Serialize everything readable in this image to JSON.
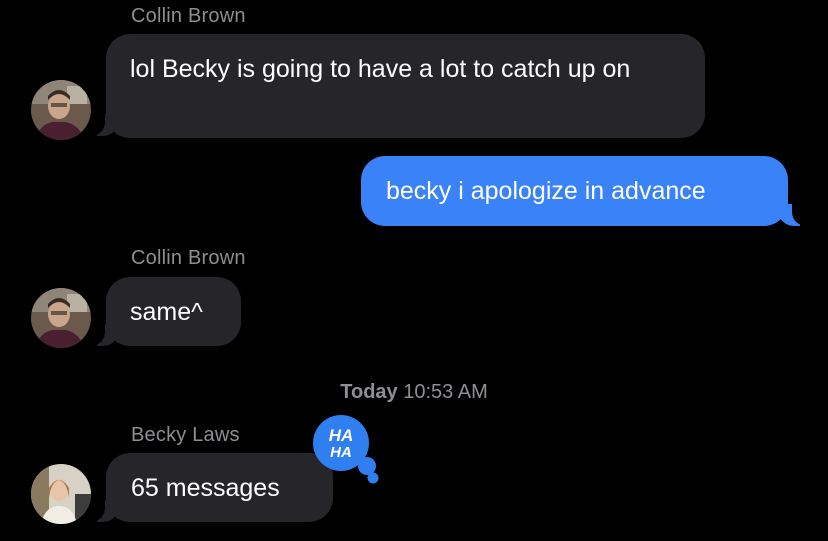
{
  "messages": [
    {
      "sender": "Collin Brown",
      "text": "lol Becky is going to have a lot to catch up on",
      "direction": "incoming"
    },
    {
      "text": "becky i apologize in advance",
      "direction": "outgoing"
    },
    {
      "sender": "Collin Brown",
      "text": "same^",
      "direction": "incoming"
    },
    {
      "sender": "Becky Laws",
      "text": "65 messages",
      "direction": "incoming",
      "tapback": "HAHA"
    }
  ],
  "timestamp": {
    "day": "Today",
    "time": "10:53 AM"
  },
  "colors": {
    "background": "#000000",
    "incoming_bubble": "#26252a",
    "outgoing_bubble": "#3a82f7",
    "secondary_text": "#8e8e93",
    "tapback": "#2f7ff0"
  },
  "icons": {
    "reaction": "haha-tapback-icon"
  }
}
